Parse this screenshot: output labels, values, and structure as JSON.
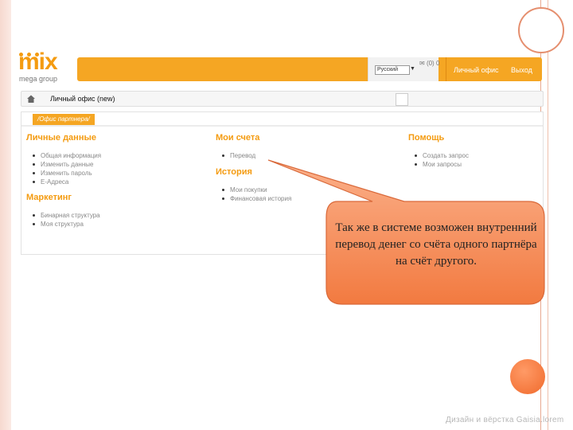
{
  "logo": {
    "wordmark": "mix",
    "tagline": "mega group"
  },
  "topbar": {
    "language_value": "Русский",
    "mail_count": "(0) 0",
    "office_link": "Личный офис",
    "logout_link": "Выход"
  },
  "breadcrumb": {
    "text": "Личный офис (new)"
  },
  "panel": {
    "tab_label": "Офис партнера",
    "personal": {
      "title": "Личные данные",
      "items": [
        "Общая информация",
        "Изменить данные",
        "Изменить пароль",
        "E-Адреса"
      ]
    },
    "marketing": {
      "title": "Маркетинг",
      "items": [
        "Бинарная структура",
        "Моя структура"
      ]
    },
    "accounts": {
      "title": "Мои счета",
      "items": [
        "Перевод"
      ]
    },
    "history": {
      "title": "История",
      "items": [
        "Мои покупки",
        "Финансовая история"
      ]
    },
    "help": {
      "title": "Помощь",
      "items": [
        "Создать запрос",
        "Мои запросы"
      ]
    }
  },
  "callout": {
    "text": "Так же в системе возможен внутренний перевод денег со счёта одного партнёра на счёт другого."
  },
  "footer": {
    "text": "Дизайн и вёрстка Gaisia.lorem"
  },
  "colors": {
    "accent": "#f5a623",
    "callout_fill": "#f58a52",
    "link_gray": "#888888"
  }
}
